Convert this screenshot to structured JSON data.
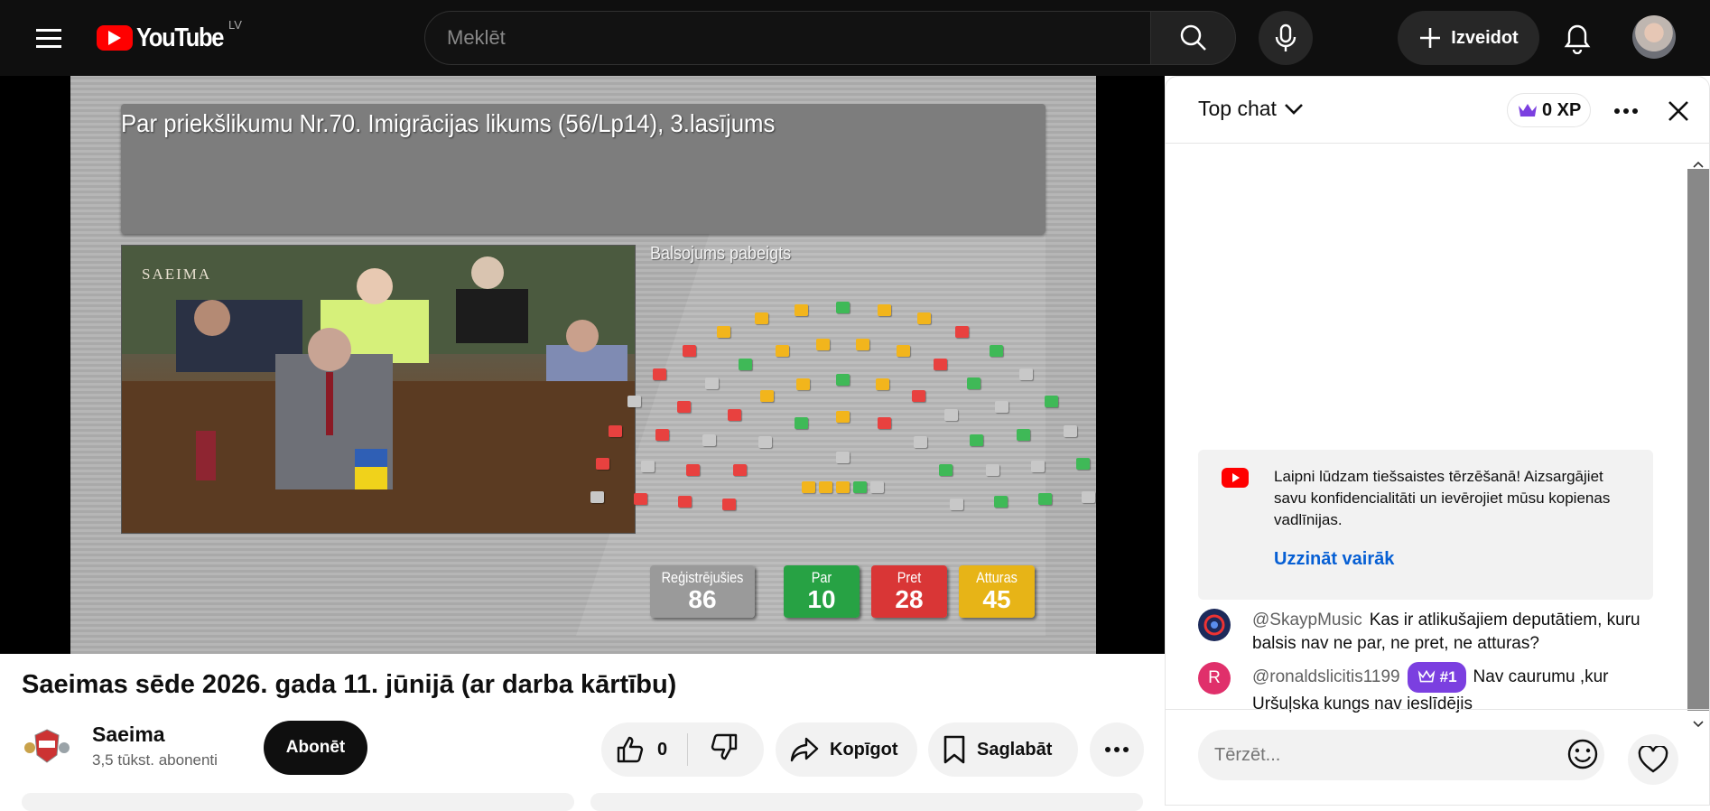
{
  "header": {
    "logo_text": "YouTube",
    "country_code": "LV",
    "search_placeholder": "Meklēt",
    "create_label": "Izveidot"
  },
  "video_frame": {
    "motion_title": "Par priekšlikumu Nr.70. Imigrācijas likums (56/Lp14), 3.lasījums",
    "status": "Balsojums pabeigts",
    "camera_watermark": "SAEIMA",
    "stats": [
      {
        "label": "Reģistrējušies",
        "value": "86",
        "color": "#9a9a9a"
      },
      {
        "label": "Par",
        "value": "10",
        "color": "#27a244"
      },
      {
        "label": "Pret",
        "value": "28",
        "color": "#d93636"
      },
      {
        "label": "Atturas",
        "value": "45",
        "color": "#e7b417"
      }
    ],
    "seat_colors": {
      "for": "#3fb957",
      "against": "#e8413f",
      "abstain": "#f2b51c",
      "absent": "#c8c8c8"
    }
  },
  "video": {
    "title": "Saeimas sēde 2026. gada 11. jūnijā (ar darba kārtību)",
    "channel_name": "Saeima",
    "subscribers": "3,5 tūkst. abonenti",
    "subscribe_label": "Abonēt",
    "likes": "0",
    "share_label": "Kopīgot",
    "save_label": "Saglabāt"
  },
  "chat": {
    "mode": "Top chat",
    "xp": "0 XP",
    "welcome_text": "Laipni lūdzam tiešsaistes tērzēšanā! Aizsargājiet savu konfidencialitāti un ievērojiet mūsu kopienas vadlīnijas.",
    "learn_more": "Uzzināt vairāk",
    "messages": [
      {
        "author": "@SkaypMusic",
        "text": "Kas ir atlikušajiem deputātiem, kuru balsis nav ne par, ne pret, ne atturas?",
        "avatar_color": "#1d2a5a"
      },
      {
        "author": "@ronaldslicitis1199",
        "badge": "#1",
        "text": "Nav caurumu ,kur Uršuļska kungs nav ieslīdējis",
        "avatar_letter": "R",
        "avatar_color": "#e0306b"
      }
    ],
    "input_placeholder": "Tērzēt..."
  },
  "icons": [
    "menu-icon",
    "youtube-play-icon",
    "search-icon",
    "mic-icon",
    "plus-icon",
    "bell-icon",
    "like-icon",
    "dislike-icon",
    "share-icon",
    "bookmark-icon",
    "more-icon",
    "chevron-down-icon",
    "crown-icon",
    "close-icon",
    "youtube-icon",
    "emoji-icon",
    "heart-icon"
  ]
}
